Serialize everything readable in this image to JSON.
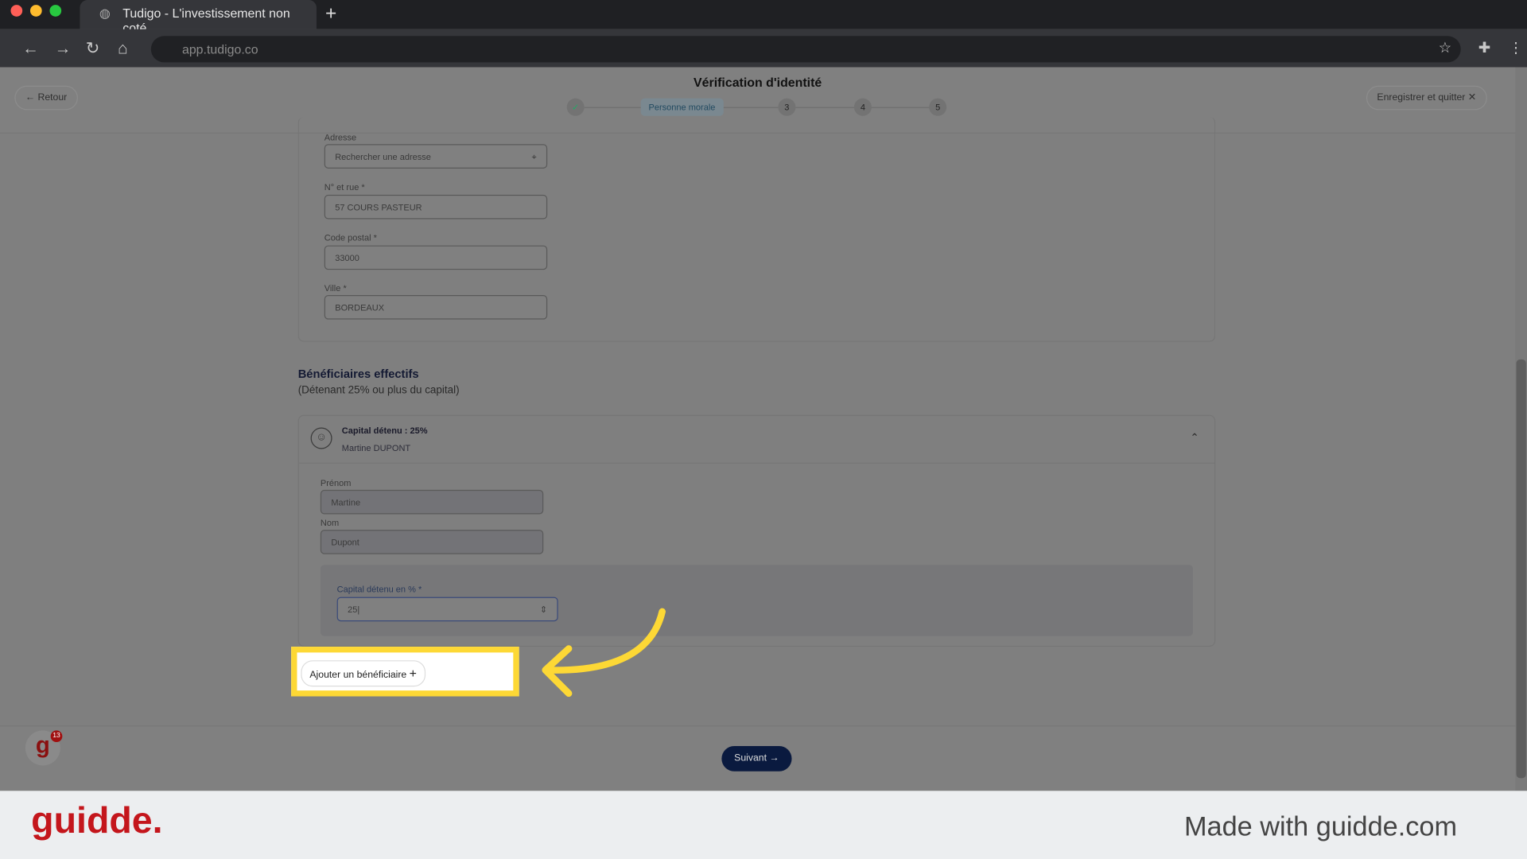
{
  "browser": {
    "tab_title": "Tudigo - L'investissement non coté",
    "url": "app.tudigo.co"
  },
  "header": {
    "back": "Retour",
    "title": "Vérification d'identité",
    "save_quit": "Enregistrer et quitter",
    "steps": [
      {
        "label": "✓",
        "state": "done"
      },
      {
        "label": "Personne morale",
        "state": "active"
      },
      {
        "label": "3"
      },
      {
        "label": "4"
      },
      {
        "label": "5"
      }
    ]
  },
  "address": {
    "adresse_label": "Adresse",
    "adresse_placeholder": "Rechercher une adresse",
    "rue_label": "N° et rue *",
    "rue_value": "57 COURS PASTEUR",
    "cp_label": "Code postal *",
    "cp_value": "33000",
    "ville_label": "Ville *",
    "ville_value": "BORDEAUX"
  },
  "beneficiaries": {
    "title": "Bénéficiaires effectifs",
    "subtitle": "(Détenant 25% ou plus du capital)",
    "card": {
      "capital": "Capital détenu : 25%",
      "name": "Martine DUPONT",
      "prenom_label": "Prénom",
      "prenom_value": "Martine",
      "nom_label": "Nom",
      "nom_value": "Dupont",
      "capital_label": "Capital détenu en % *",
      "capital_value": "25"
    },
    "add_button": "Ajouter un bénéficiaire"
  },
  "footer": {
    "next": "Suivant"
  },
  "guidde": {
    "logo": "guidde.",
    "made_with": "Made with guidde.com",
    "badge": "13"
  },
  "colors": {
    "highlight": "#fdd835",
    "brand": "#c4161c",
    "primary": "#0a1a3f"
  }
}
